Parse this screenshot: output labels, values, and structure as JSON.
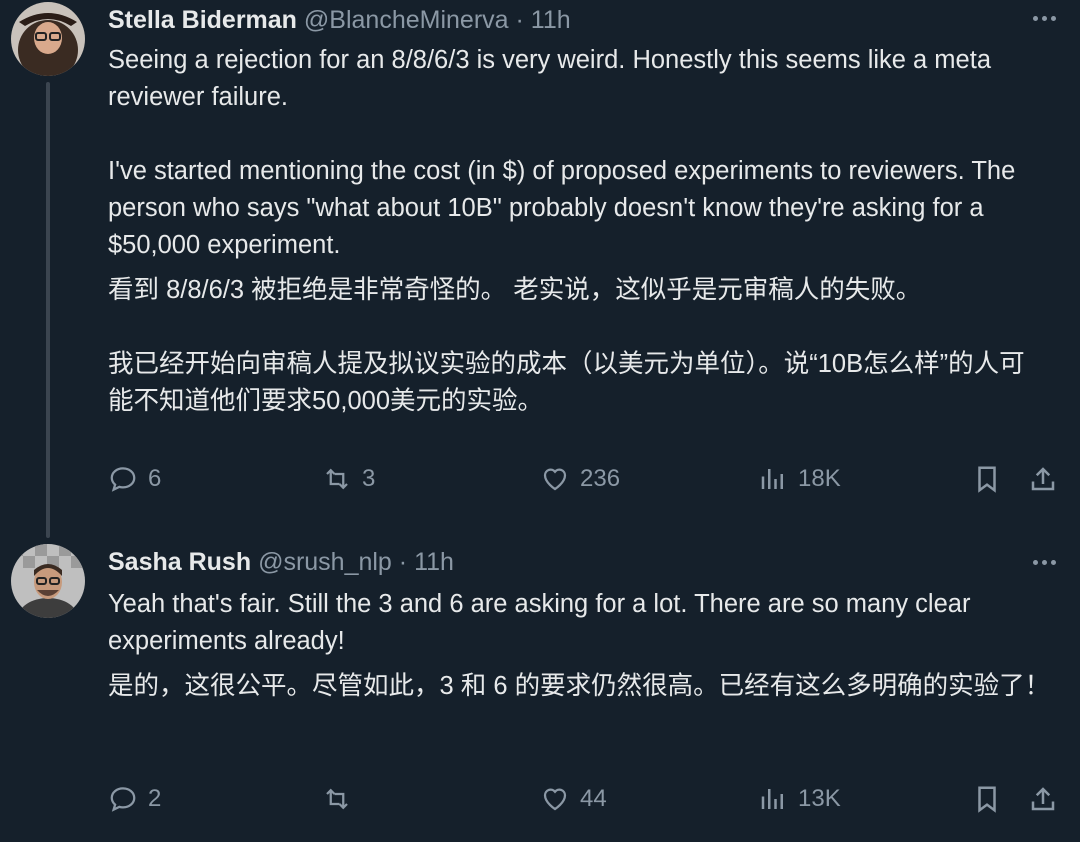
{
  "tweets": [
    {
      "name": "Stella Biderman",
      "handle": "@BlancheMinerva",
      "separator": "·",
      "time": "11h",
      "text_en_1": "Seeing a rejection for an 8/8/6/3 is very weird.  Honestly this seems like a meta reviewer failure.",
      "text_en_2": "I've started mentioning the cost (in $) of proposed experiments to reviewers. The person who says \"what about 10B\" probably doesn't know they're asking for a $50,000 experiment.",
      "text_zh_1": "看到 8/8/6/3 被拒绝是非常奇怪的。 老实说，这似乎是元审稿人的失败。",
      "text_zh_2": "我已经开始向审稿人提及拟议实验的成本（以美元为单位）。说“10B怎么样”的人可能不知道他们要求50,000美元的实验。",
      "replies": "6",
      "retweets": "3",
      "likes": "236",
      "views": "18K"
    },
    {
      "name": "Sasha Rush",
      "handle": "@srush_nlp",
      "separator": "·",
      "time": "11h",
      "text_en_1": "Yeah that's fair. Still the 3 and 6 are asking for a lot. There are so many clear experiments already!",
      "text_zh_1": "是的，这很公平。尽管如此，3 和 6 的要求仍然很高。已经有这么多明确的实验了！",
      "replies": "2",
      "retweets": "",
      "likes": "44",
      "views": "13K"
    }
  ],
  "icons": {
    "reply": "speech-bubble-icon",
    "retweet": "retweet-arrows-icon",
    "like": "heart-icon",
    "views": "bar-chart-icon",
    "bookmark": "bookmark-icon",
    "share": "share-upload-icon",
    "more": "more-dots-icon"
  },
  "colors": {
    "background": "#15202b",
    "text": "#e7e9ea",
    "muted": "#8b98a5"
  }
}
